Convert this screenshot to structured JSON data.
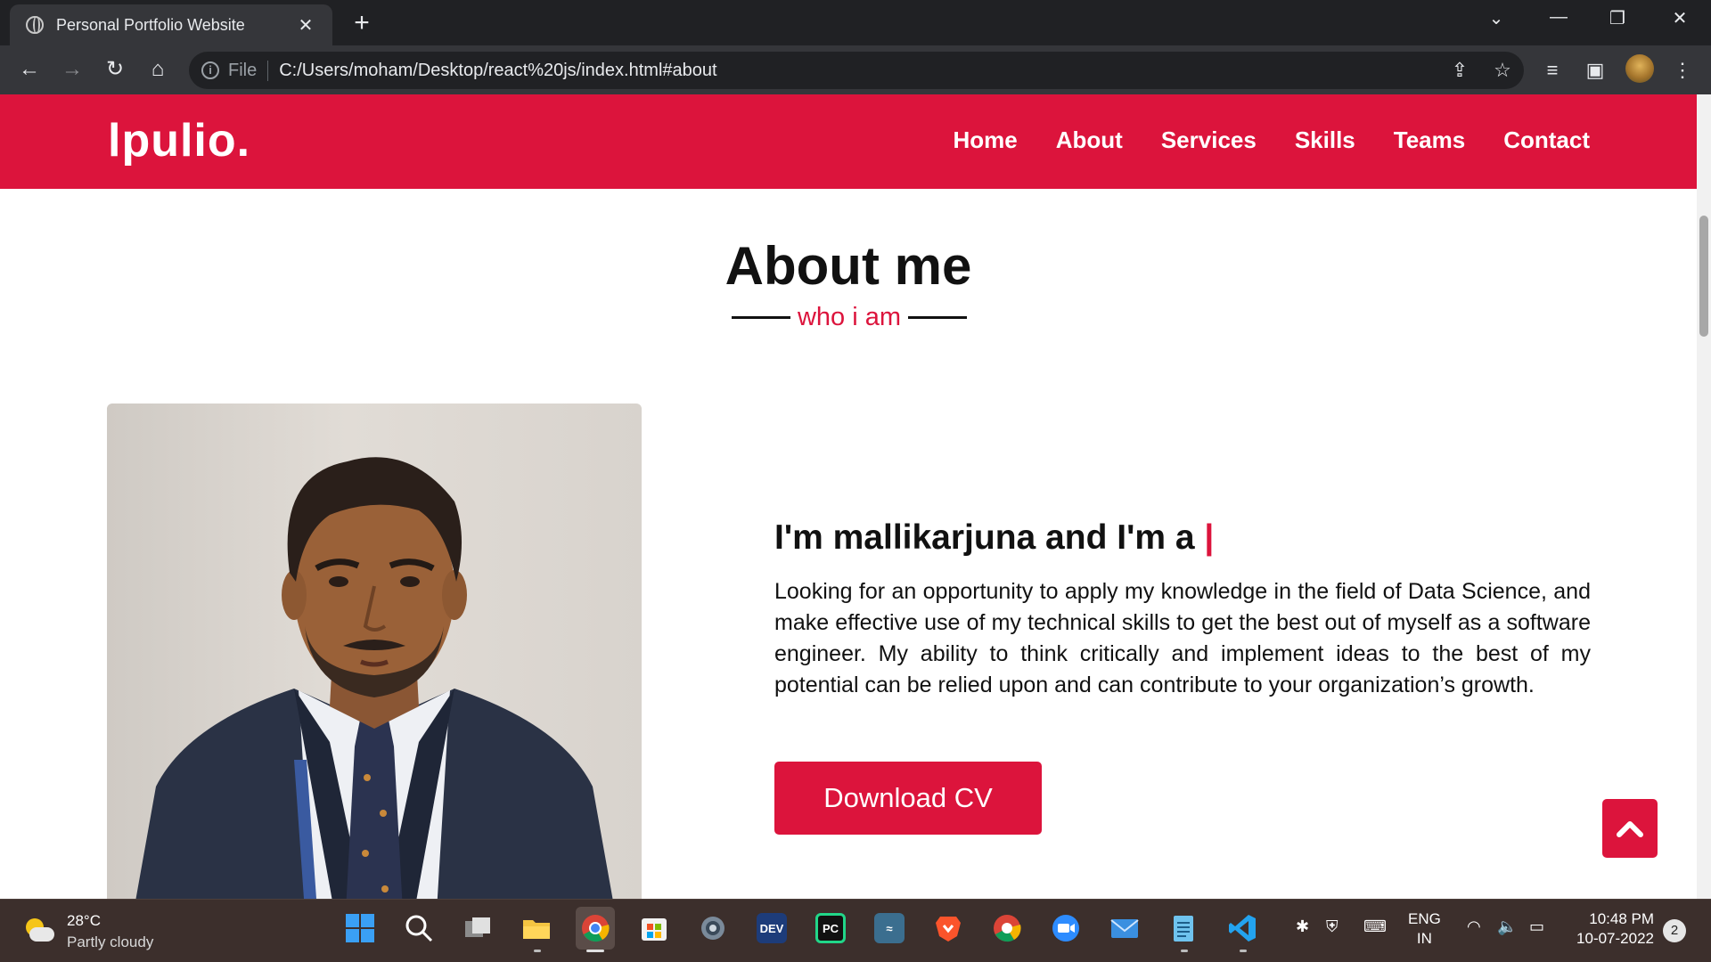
{
  "browser": {
    "tab_title": "Personal Portfolio Website",
    "tab_close": "✕",
    "new_tab": "+",
    "url_scheme": "File",
    "url": "C:/Users/moham/Desktop/react%20js/index.html#about",
    "icons": [
      "globe-icon",
      "back-icon",
      "forward-icon",
      "reload-icon",
      "home-icon",
      "info-icon",
      "share-icon",
      "star-icon",
      "reading-list-icon",
      "side-panel-icon",
      "profile-avatar",
      "menu-icon"
    ]
  },
  "site": {
    "logo": "lpulio.",
    "nav": [
      "Home",
      "About",
      "Services",
      "Skills",
      "Teams",
      "Contact"
    ],
    "about": {
      "title": "About me",
      "subtitle": "who i am",
      "headline": "I'm mallikarjuna and I'm a",
      "cursor": "|",
      "paragraph": "Looking for an opportunity to apply my knowledge in the field of Data Science, and make effective use of my technical skills to get the best out of myself as a software engineer. My ability to think critically and implement ideas to the best of my potential can be relied upon and can contribute to your organization’s growth.",
      "button": "Download CV"
    },
    "accent_color": "#dc143c"
  },
  "taskbar": {
    "weather_temp": "28°C",
    "weather_desc": "Partly cloudy",
    "lang_1": "ENG",
    "lang_2": "IN",
    "time": "10:48 PM",
    "date": "10-07-2022",
    "notifications": "2",
    "apps": [
      "start",
      "search",
      "task-view",
      "file-explorer",
      "chrome",
      "microsoft-store",
      "settings",
      "dev-cpp",
      "pycharm",
      "mysql-workbench",
      "brave",
      "chrome-2",
      "zoom",
      "mail",
      "notepad",
      "vscode"
    ],
    "app_labels": {
      "dev": "DEV",
      "pc": "PC"
    }
  }
}
